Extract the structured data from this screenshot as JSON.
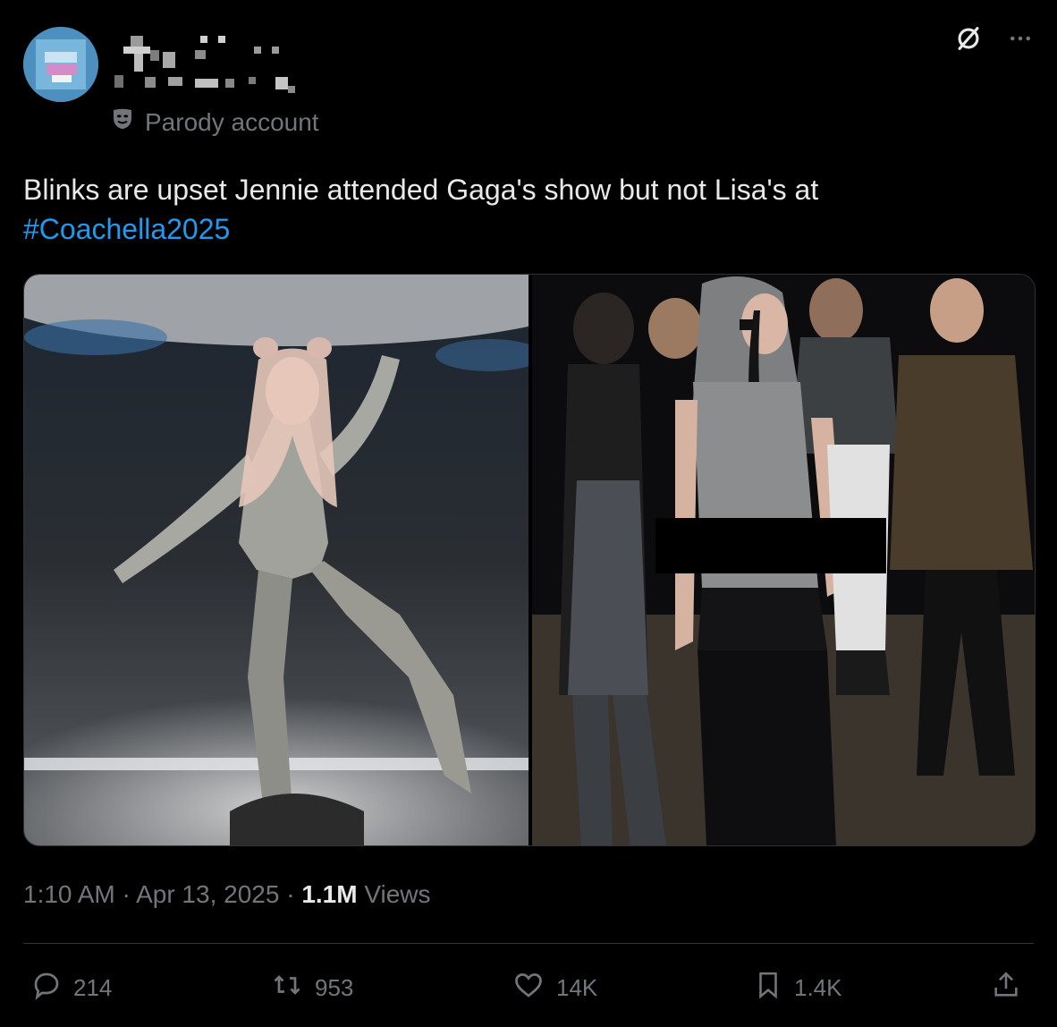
{
  "account": {
    "badge_label": "Parody account"
  },
  "tweet": {
    "text": "Blinks are upset Jennie attended Gaga's show but not Lisa's at",
    "hashtag": "#Coachella2025"
  },
  "meta": {
    "time": "1:10 AM",
    "sep1": "·",
    "date": "Apr 13, 2025",
    "sep2": "·",
    "views_count": "1.1M",
    "views_label": "Views"
  },
  "actions": {
    "replies": "214",
    "reposts": "953",
    "likes": "14K",
    "bookmarks": "1.4K"
  },
  "icons": {
    "grok": "grok-icon",
    "more": "more-icon",
    "reply": "reply-icon",
    "repost": "repost-icon",
    "like": "heart-icon",
    "bookmark": "bookmark-icon",
    "share": "share-icon"
  },
  "colors": {
    "background": "#000000",
    "text": "#e7e9ea",
    "secondary": "#71767b",
    "link": "#1d9bf0",
    "border": "#2f3336"
  }
}
